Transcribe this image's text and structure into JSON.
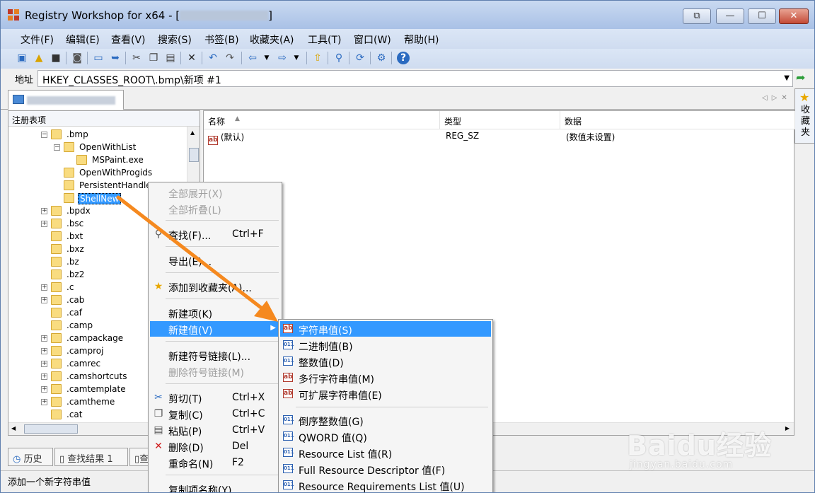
{
  "window": {
    "title": "Registry Workshop for x64 - [",
    "title_suffix": "]",
    "btn_restore": "⧉",
    "btn_minimize": "—",
    "btn_maximize": "☐",
    "btn_close": "✕"
  },
  "menu": [
    "文件(F)",
    "编辑(E)",
    "查看(V)",
    "搜索(S)",
    "书签(B)",
    "收藏夹(A)",
    "工具(T)",
    "窗口(W)",
    "帮助(H)"
  ],
  "address": {
    "label": "地址",
    "value": "HKEY_CLASSES_ROOT\\.bmp\\新项 #1"
  },
  "favorites_side": {
    "label": "收藏夹"
  },
  "tree": {
    "header": "注册表项",
    "items": [
      ".bmp",
      "OpenWithList",
      "MSPaint.exe",
      "OpenWithProgids",
      "PersistentHandle",
      "ShellNew",
      ".bpdx",
      ".bsc",
      ".bxt",
      ".bxz",
      ".bz",
      ".bz2",
      ".c",
      ".cab",
      ".caf",
      ".camp",
      ".campackage",
      ".camproj",
      ".camrec",
      ".camshortcuts",
      ".camtemplate",
      ".camtheme",
      ".cat"
    ]
  },
  "list": {
    "col_name": "名称",
    "col_type": "类型",
    "col_data": "数据",
    "row": {
      "name": "(默认)",
      "type": "REG_SZ",
      "data": "(数值未设置)"
    }
  },
  "context_menu": {
    "expand_all": "全部展开(X)",
    "collapse_all": "全部折叠(L)",
    "find": "查找(F)...",
    "find_sc": "Ctrl+F",
    "export": "导出(E)...",
    "add_fav": "添加到收藏夹(A)...",
    "new_key": "新建项(K)",
    "new_value": "新建值(V)",
    "new_link": "新建符号链接(L)...",
    "del_link": "删除符号链接(M)",
    "cut": "剪切(T)",
    "cut_sc": "Ctrl+X",
    "copy": "复制(C)",
    "copy_sc": "Ctrl+C",
    "paste": "粘贴(P)",
    "paste_sc": "Ctrl+V",
    "delete": "删除(D)",
    "delete_sc": "Del",
    "rename": "重命名(N)",
    "rename_sc": "F2",
    "copy_key_name": "复制项名称(Y)"
  },
  "submenu": {
    "string": "字符串值(S)",
    "binary": "二进制值(B)",
    "dword": "整数值(D)",
    "multi": "多行字符串值(M)",
    "expand": "可扩展字符串值(E)",
    "big_endian": "倒序整数值(G)",
    "qword": "QWORD 值(Q)",
    "res_list": "Resource List 值(R)",
    "full_res": "Full Resource Descriptor 值(F)",
    "res_req": "Resource Requirements List 值(U)"
  },
  "bottom_tabs": {
    "history": "历史",
    "results": "查找结果 1",
    "third": "查"
  },
  "status": {
    "text": "添加一个新字符串值"
  },
  "watermark": {
    "big": "Baidu经验",
    "small": "jingyan.baidu.com"
  },
  "colors": {
    "highlight": "#3399ff",
    "arrow": "#f5891f"
  }
}
